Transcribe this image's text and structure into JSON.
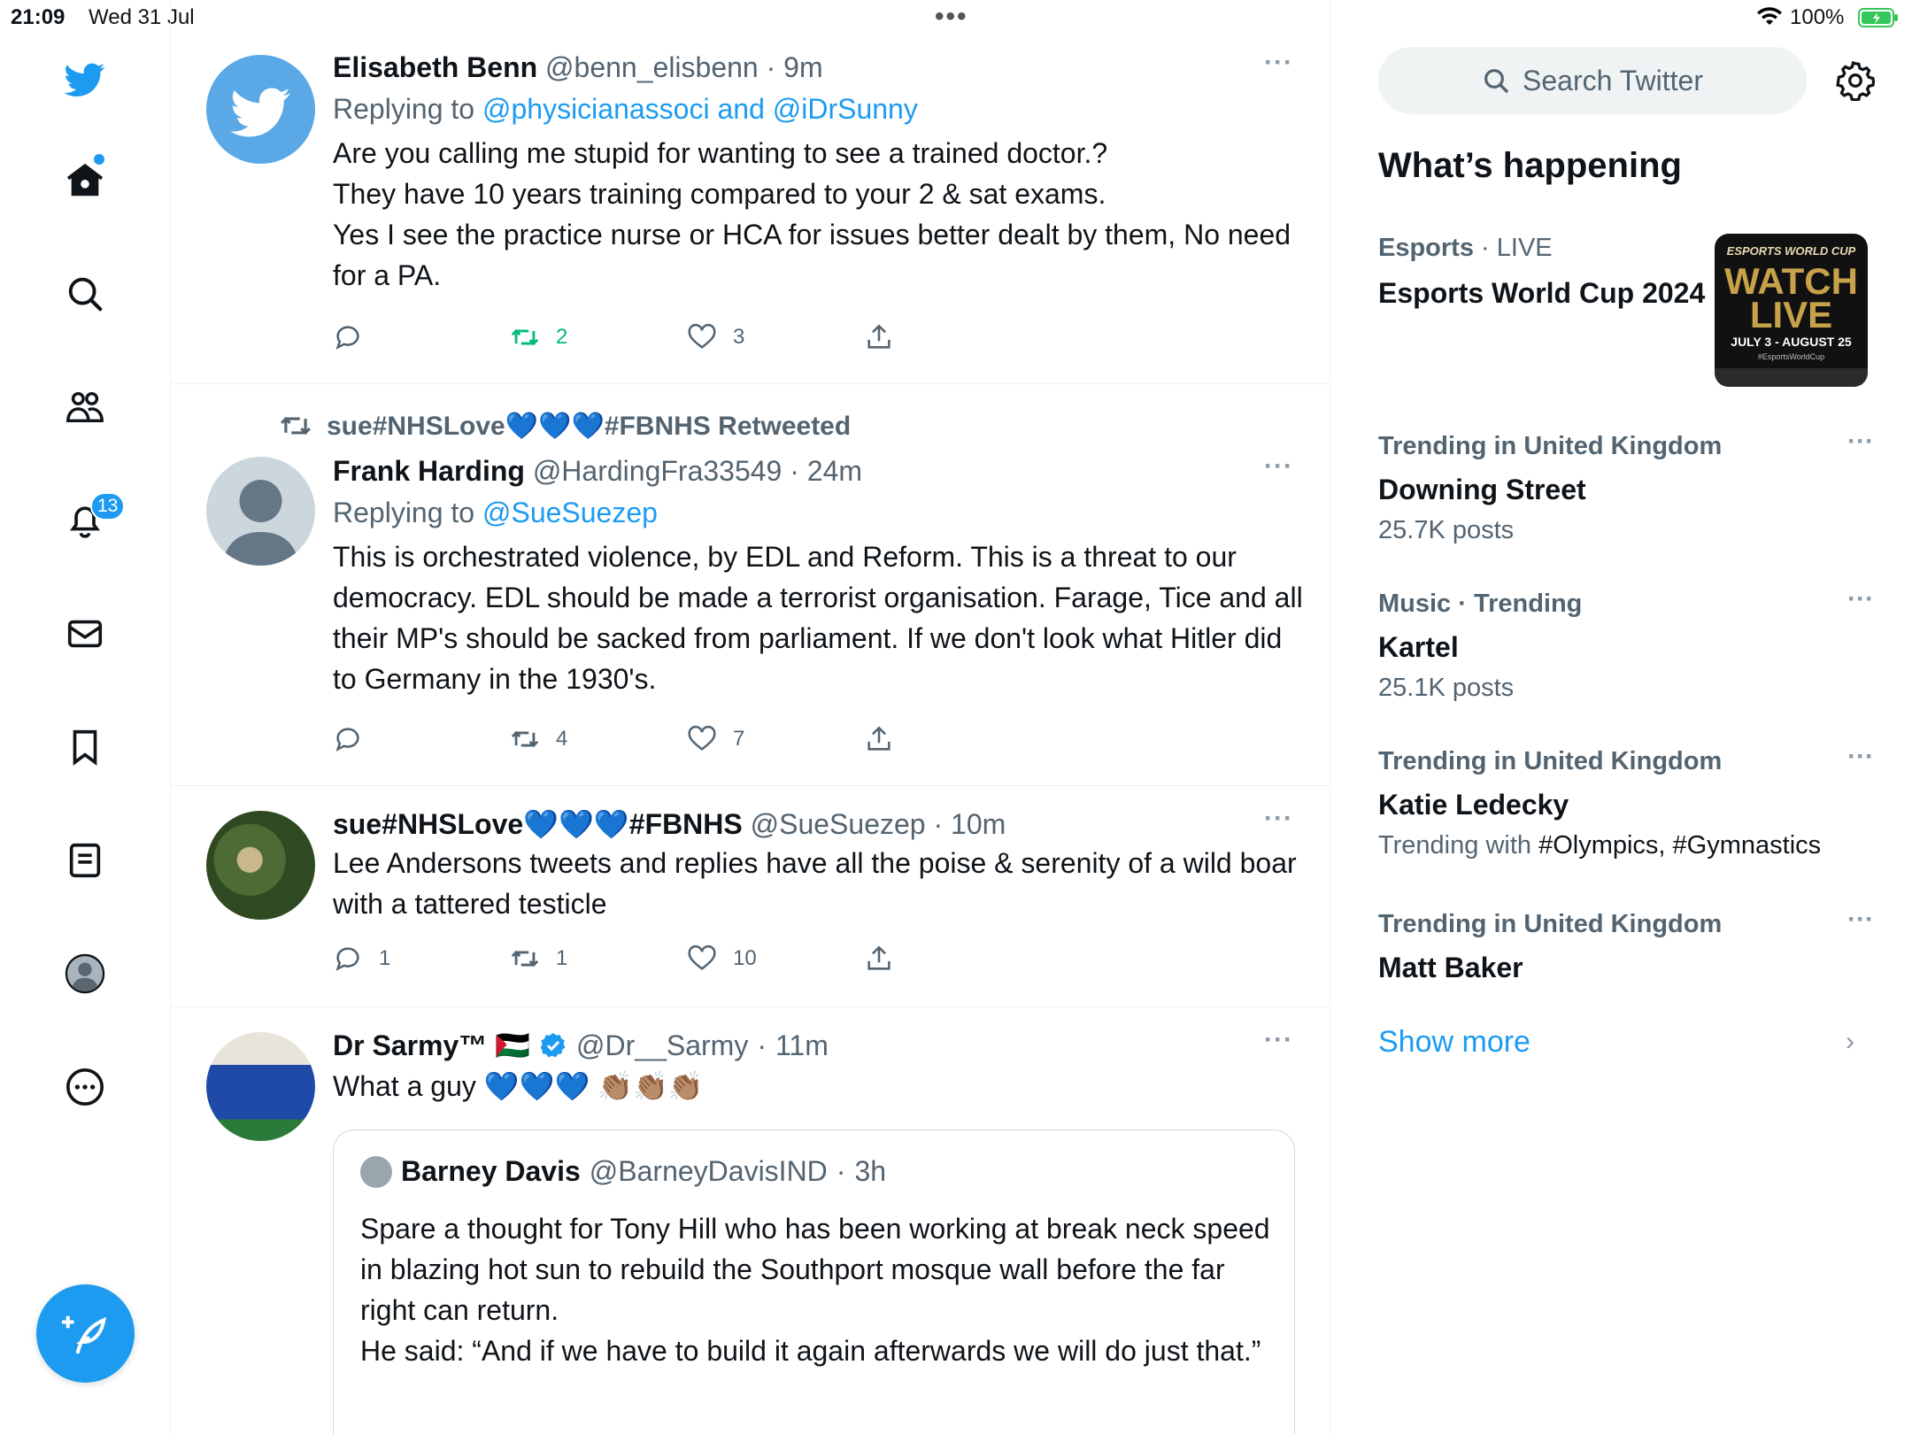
{
  "status_bar": {
    "time": "21:09",
    "date": "Wed 31 Jul",
    "battery": "100%",
    "dots": "•••"
  },
  "sidebar": {
    "notifications_badge": "13",
    "items": [
      "twitter-logo-icon",
      "home-icon",
      "search-icon",
      "communities-icon",
      "notifications-icon",
      "messages-icon",
      "bookmarks-icon",
      "lists-icon",
      "profile-icon",
      "more-icon"
    ]
  },
  "timeline": {
    "tweets": [
      {
        "name": "Elisabeth Benn",
        "handle": "@benn_elisbenn",
        "time": "9m",
        "reply_prefix": "Replying to",
        "reply_to": "@physicianassoci and @iDrSunny",
        "text": "Are you calling me stupid for wanting to see a trained doctor.?\nThey have 10 years training compared to your 2 & sat exams.\nYes I see the practice nurse or HCA for issues better dealt by them, No need for a PA.",
        "retweets": "2",
        "likes": "3",
        "replies": ""
      },
      {
        "retweeted_by": "sue#NHSLove💙💙💙#FBNHS Retweeted",
        "name": "Frank Harding",
        "handle": "@HardingFra33549",
        "time": "24m",
        "reply_prefix": "Replying to",
        "reply_to": "@SueSuezep",
        "text": "This is orchestrated violence, by EDL and Reform. This is a threat to our democracy. EDL should be made a terrorist organisation. Farage, Tice and all their MP's should be sacked from parliament. If we don't look what Hitler did to Germany in the 1930's.",
        "retweets": "4",
        "likes": "7",
        "replies": ""
      },
      {
        "name": "sue#NHSLove💙💙💙#FBNHS",
        "handle": "@SueSuezep",
        "time": "10m",
        "text": "Lee Andersons tweets and replies have all the poise & serenity of a wild boar with a tattered testicle",
        "replies": "1",
        "retweets": "1",
        "likes": "10"
      },
      {
        "name": "Dr Sarmy™ 🇵🇸",
        "handle": "@Dr__Sarmy",
        "time": "11m",
        "text": "What a guy 💙💙💙 👏🏽👏🏽👏🏽",
        "quote": {
          "name": "Barney Davis",
          "handle": "@BarneyDavisIND",
          "time": "3h",
          "text": "Spare a thought for Tony Hill who has been working at break neck speed in blazing hot sun to rebuild the Southport mosque wall before the far right can return.\nHe said: “And if we have to build it again afterwards we will do just that.”"
        }
      }
    ]
  },
  "right": {
    "search_placeholder": "Search Twitter",
    "section_title": "What’s happening",
    "trends": [
      {
        "category": "Esports",
        "meta_suffix": " · LIVE",
        "title": "Esports World Cup 2024",
        "sub": "",
        "image_text": [
          "ESPORTS WORLD CUP",
          "WATCH",
          "LIVE",
          "JULY 3 - AUGUST 25",
          "#EsportsWorldCup"
        ]
      },
      {
        "category": "Trending in United Kingdom",
        "title": "Downing Street",
        "sub": "25.7K posts"
      },
      {
        "category": "Music · Trending",
        "title": "Kartel",
        "sub": "25.1K posts"
      },
      {
        "category": "Trending in United Kingdom",
        "title": "Katie Ledecky",
        "sub_prefix": "Trending with ",
        "sub_tags": "#Olympics, #Gymnastics"
      },
      {
        "category": "Trending in United Kingdom",
        "title": "Matt Baker",
        "sub": ""
      }
    ],
    "show_more": "Show more",
    "more_dots": "···"
  },
  "colors": {
    "accent": "#1d9bf0",
    "retweet_green": "#00ba7c",
    "secondary_text": "#536471"
  }
}
